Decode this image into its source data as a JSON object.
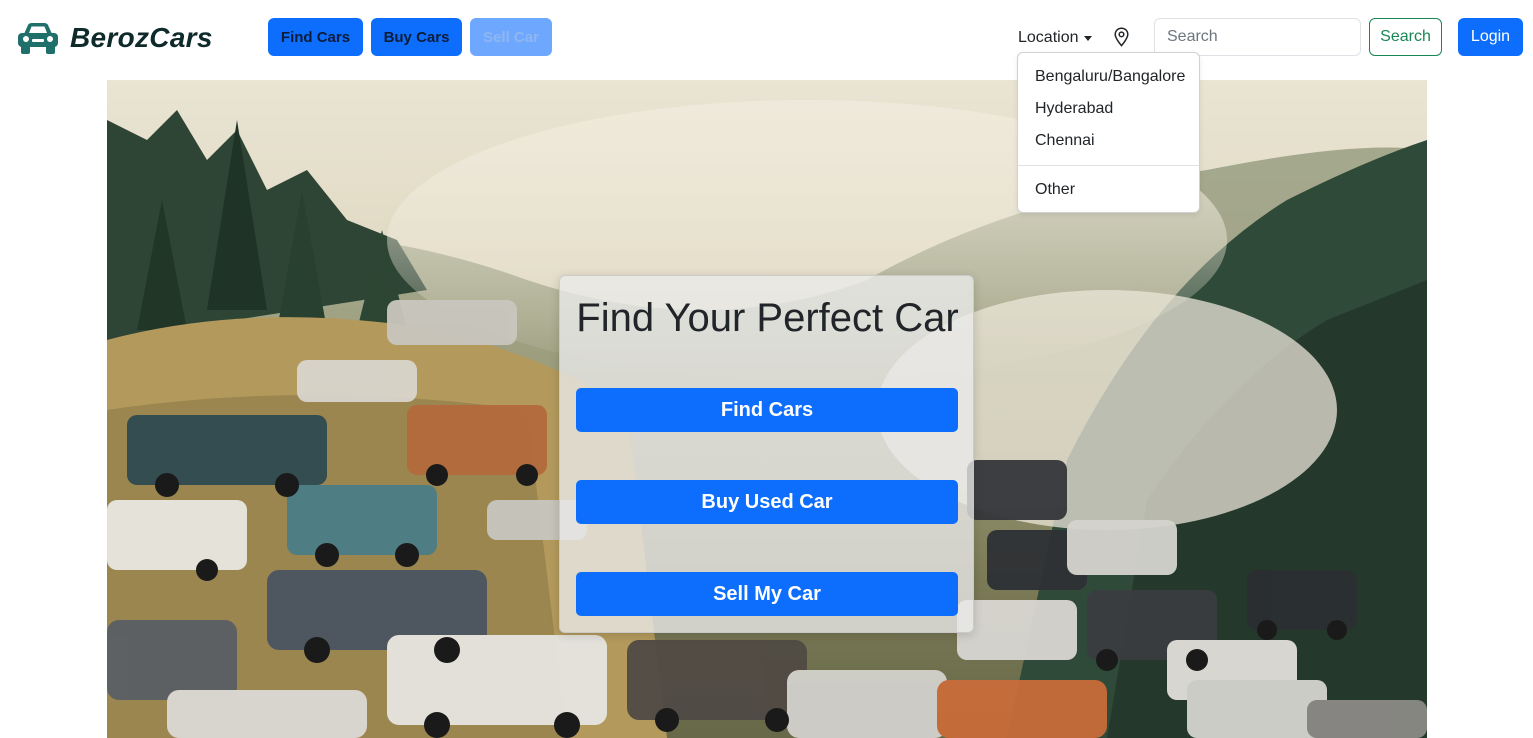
{
  "brand": {
    "name": "BerozCars",
    "logo_icon": "car-icon",
    "logo_color": "#1f6f6a"
  },
  "nav": {
    "find_cars": "Find Cars",
    "buy_cars": "Buy Cars",
    "sell_car": "Sell Car",
    "location_label": "Location",
    "location_icon": "map-pin-icon",
    "search_placeholder": "Search",
    "search_button": "Search",
    "login_button": "Login"
  },
  "location_dropdown": {
    "items": [
      "Bengaluru/Bangalore",
      "Hyderabad",
      "Chennai"
    ],
    "other": "Other"
  },
  "hero": {
    "title": "Find Your Perfect Car",
    "buttons": [
      "Find Cars",
      "Buy Used Car",
      "Sell My Car"
    ]
  },
  "colors": {
    "primary": "#0d6efd",
    "primary_disabled": "#6ea8fe",
    "success": "#198754",
    "brand_text": "#0f2a2a"
  }
}
